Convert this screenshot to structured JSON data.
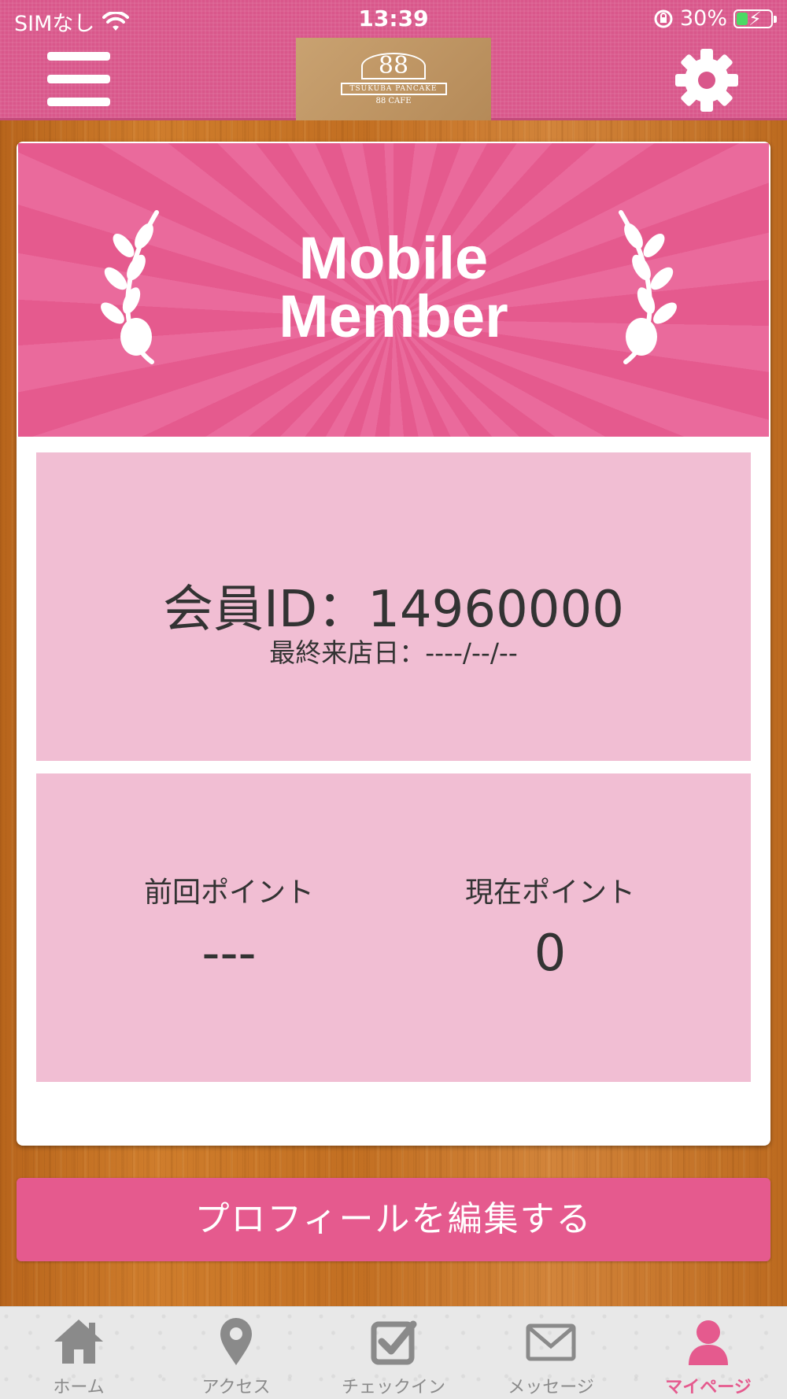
{
  "status_bar": {
    "carrier": "SIMなし",
    "time": "13:39",
    "battery_percent": "30%"
  },
  "header": {
    "logo_number": "88",
    "logo_ribbon": "TSUKUBA PANCAKE",
    "logo_sub": "88 CAFE",
    "menu_icon": "hamburger-menu-icon",
    "settings_icon": "gear-icon"
  },
  "banner": {
    "line1": "Mobile",
    "line2": "Member"
  },
  "member": {
    "id_text": "会員ID：14960000",
    "last_visit_text": "最終来店日：----/--/--"
  },
  "points": {
    "previous_label": "前回ポイント",
    "previous_value": "---",
    "current_label": "現在ポイント",
    "current_value": "0"
  },
  "edit_profile_label": "プロフィールを編集する",
  "tabs": [
    {
      "label": "ホーム",
      "icon": "home-icon",
      "active": false
    },
    {
      "label": "アクセス",
      "icon": "map-pin-icon",
      "active": false
    },
    {
      "label": "チェックイン",
      "icon": "checkbox-icon",
      "active": false
    },
    {
      "label": "メッセージ",
      "icon": "envelope-icon",
      "active": false
    },
    {
      "label": "マイページ",
      "icon": "person-icon",
      "active": true
    }
  ],
  "colors": {
    "header_pink": "#d9578b",
    "banner_pink": "#e55a8e",
    "panel_pink": "#f1bed3",
    "active_tab": "#e55a8e"
  }
}
